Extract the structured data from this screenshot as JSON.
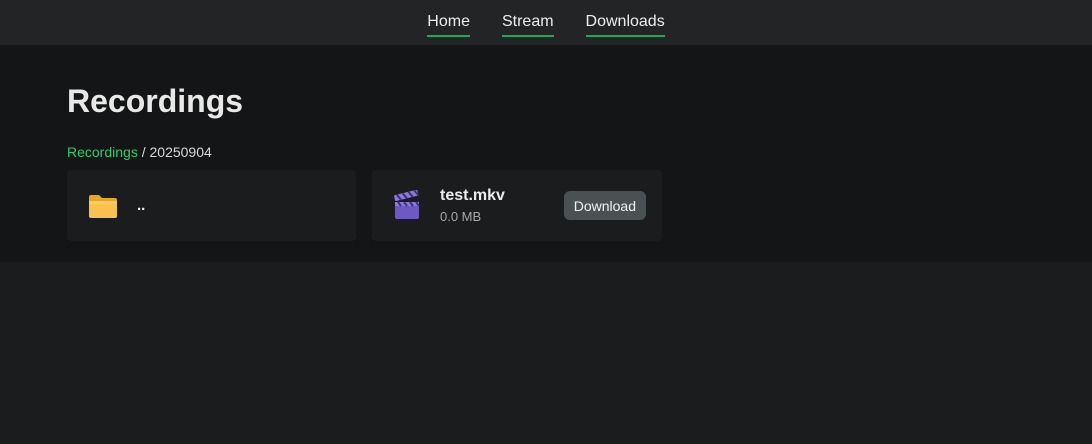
{
  "nav": {
    "items": [
      {
        "label": "Home"
      },
      {
        "label": "Stream"
      },
      {
        "label": "Downloads"
      }
    ]
  },
  "page": {
    "title": "Recordings"
  },
  "breadcrumb": {
    "root_label": "Recordings",
    "separator": "/",
    "current": "20250904"
  },
  "entries": [
    {
      "type": "folder",
      "icon": "folder-icon",
      "name": ".."
    },
    {
      "type": "file",
      "icon": "clapperboard-icon",
      "name": "test.mkv",
      "size": "0.0 MB",
      "action_label": "Download"
    }
  ],
  "colors": {
    "accent": "#2ecc71",
    "nav_underline": "#1fa85a",
    "folder": "#f6b73c",
    "clapper": "#7a63c9"
  }
}
